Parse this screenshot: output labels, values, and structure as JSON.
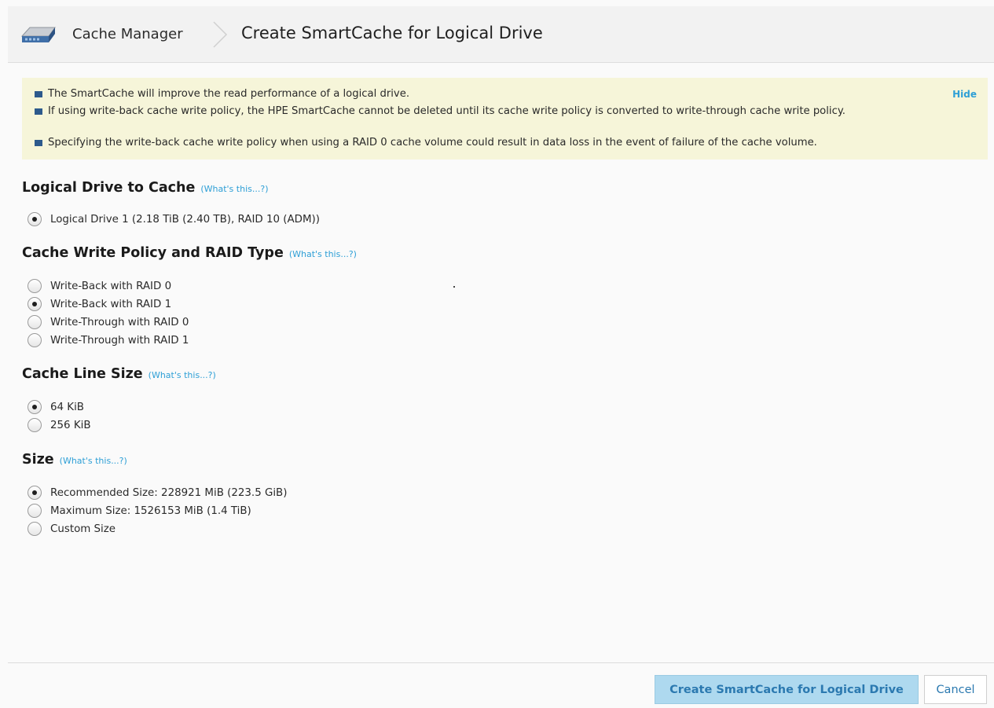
{
  "header": {
    "icon": "drive-icon",
    "breadcrumb_parent": "Cache Manager",
    "page_title": "Create SmartCache for Logical Drive"
  },
  "notice": {
    "lines": [
      "The SmartCache will improve the read performance of a logical drive.",
      "If using write-back cache write policy, the HPE SmartCache cannot be deleted until its cache write policy is converted to write-through cache write policy.",
      "Specifying the write-back cache write policy when using a RAID 0 cache volume could result in data loss in the event of failure of the cache volume."
    ],
    "hide_label": "Hide"
  },
  "whats_this_label": "(What's this...?)",
  "sections": {
    "logical_drive": {
      "title": "Logical Drive to Cache",
      "options": [
        "Logical Drive 1 (2.18 TiB (2.40 TB), RAID 10 (ADM))"
      ],
      "selected": 0
    },
    "write_policy": {
      "title": "Cache Write Policy and RAID Type",
      "options": [
        "Write-Back with RAID 0",
        "Write-Back with RAID 1",
        "Write-Through with RAID 0",
        "Write-Through with RAID 1"
      ],
      "selected": 1
    },
    "line_size": {
      "title": "Cache Line Size",
      "options": [
        "64 KiB",
        "256 KiB"
      ],
      "selected": 0
    },
    "size": {
      "title": "Size",
      "options": [
        "Recommended Size: 228921 MiB (223.5 GiB)",
        "Maximum Size: 1526153 MiB (1.4 TiB)",
        "Custom Size"
      ],
      "selected": 0
    }
  },
  "footer": {
    "create_label": "Create SmartCache for Logical Drive",
    "cancel_label": "Cancel"
  },
  "colors": {
    "accent_link": "#2e9fd6",
    "notice_bg": "#f6f5d9",
    "bullet": "#2d5a8c",
    "primary_button_bg": "#aed9ef"
  }
}
